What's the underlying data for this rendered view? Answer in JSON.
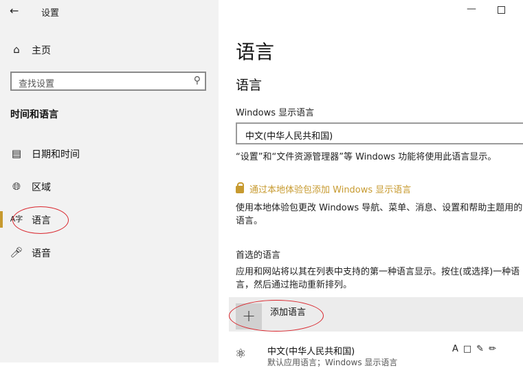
{
  "window": {
    "title": "设置",
    "back_icon": "back-arrow-icon"
  },
  "sidebar": {
    "home_label": "主页",
    "search_placeholder": "查找设置",
    "section_title": "时间和语言",
    "items": [
      {
        "label": "日期和时间",
        "icon": "calendar-clock-icon"
      },
      {
        "label": "区域",
        "icon": "globe-icon"
      },
      {
        "label": "语言",
        "icon": "language-icon",
        "selected": true
      },
      {
        "label": "语音",
        "icon": "microphone-icon"
      }
    ],
    "accent_color": "#c79a2f"
  },
  "main": {
    "page_title": "语言",
    "section_heading": "语言",
    "display_language_label": "Windows 显示语言",
    "display_language_value": "中文(中华人民共和国)",
    "display_language_note": "“设置”和“文件资源管理器”等 Windows 功能将使用此语言显示。",
    "local_experience_link": "通过本地体验包添加 Windows 显示语言",
    "local_experience_desc": "使用本地体验包更改 Windows 导航、菜单、消息、设置和帮助主题用的语言。",
    "preferred_label": "首选的语言",
    "preferred_desc": "应用和网站将以其在列表中支持的第一种语言显示。按住(或选择)一种语言，然后通过拖动重新排列。",
    "add_language_label": "添加语言",
    "languages": [
      {
        "name": "中文(中华人民共和国)",
        "sub": "默认应用语言；Windows 显示语言"
      }
    ]
  }
}
